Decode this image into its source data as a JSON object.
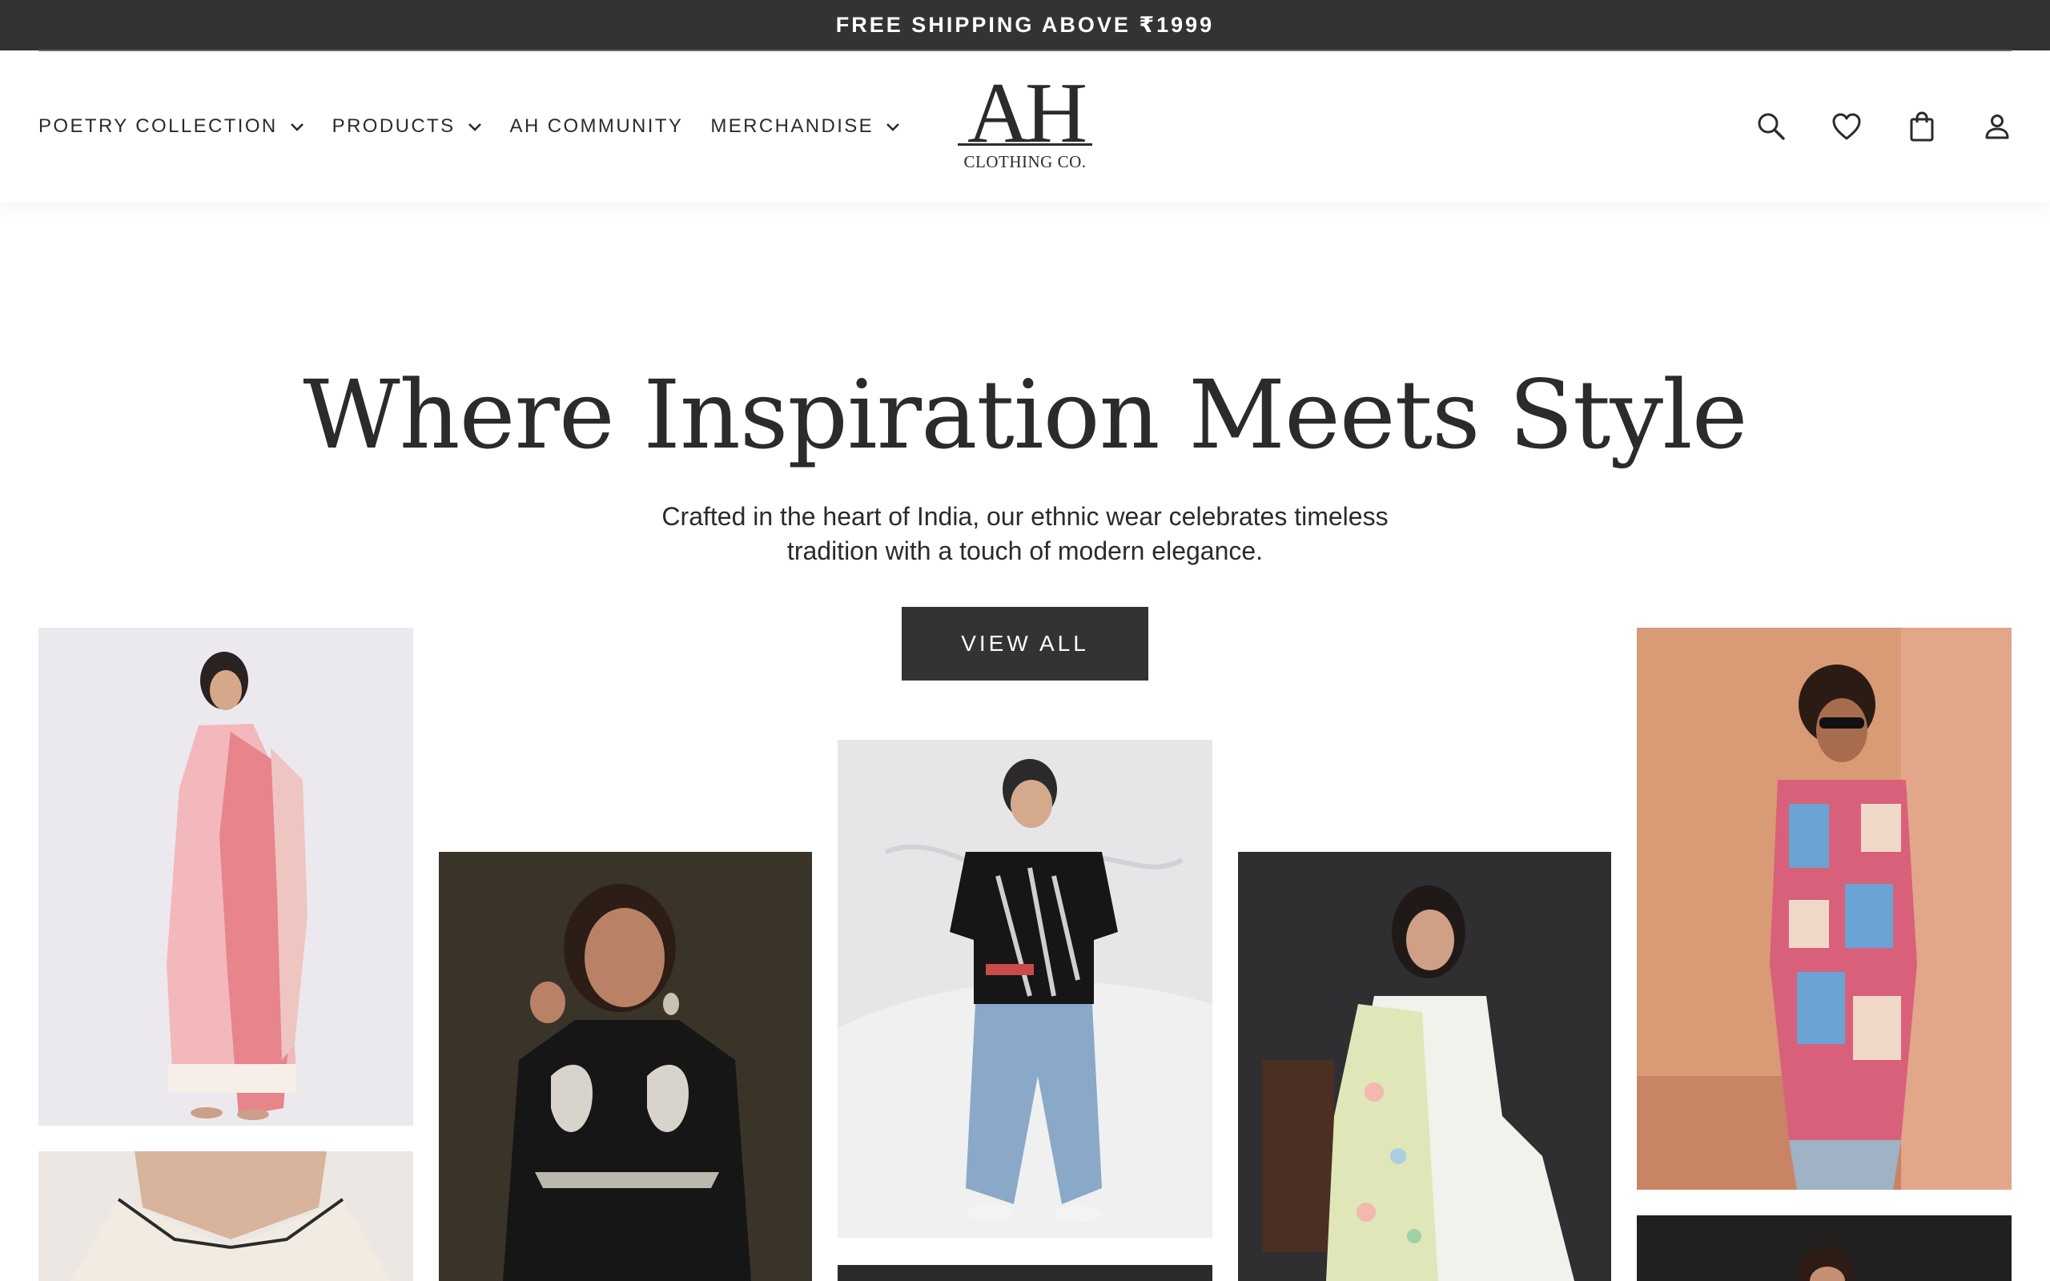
{
  "announcement": {
    "text": "FREE SHIPPING ABOVE ₹1999"
  },
  "nav": {
    "items": [
      {
        "label": "POETRY COLLECTION",
        "has_dropdown": true
      },
      {
        "label": "PRODUCTS",
        "has_dropdown": true
      },
      {
        "label": "AH COMMUNITY",
        "has_dropdown": false
      },
      {
        "label": "MERCHANDISE",
        "has_dropdown": true
      }
    ]
  },
  "logo": {
    "mark": "AH",
    "subtitle": "CLOTHING CO."
  },
  "actions": [
    "search-icon",
    "heart-icon",
    "bag-icon",
    "account-icon"
  ],
  "hero": {
    "title": "Where Inspiration Meets Style",
    "subtitle_line1": "Crafted in the heart of India, our ethnic wear celebrates timeless",
    "subtitle_line2": "tradition with a touch of modern elegance.",
    "cta": "VIEW ALL"
  },
  "colors": {
    "dark": "#333333",
    "text": "#2b2b2b",
    "white": "#ffffff"
  }
}
